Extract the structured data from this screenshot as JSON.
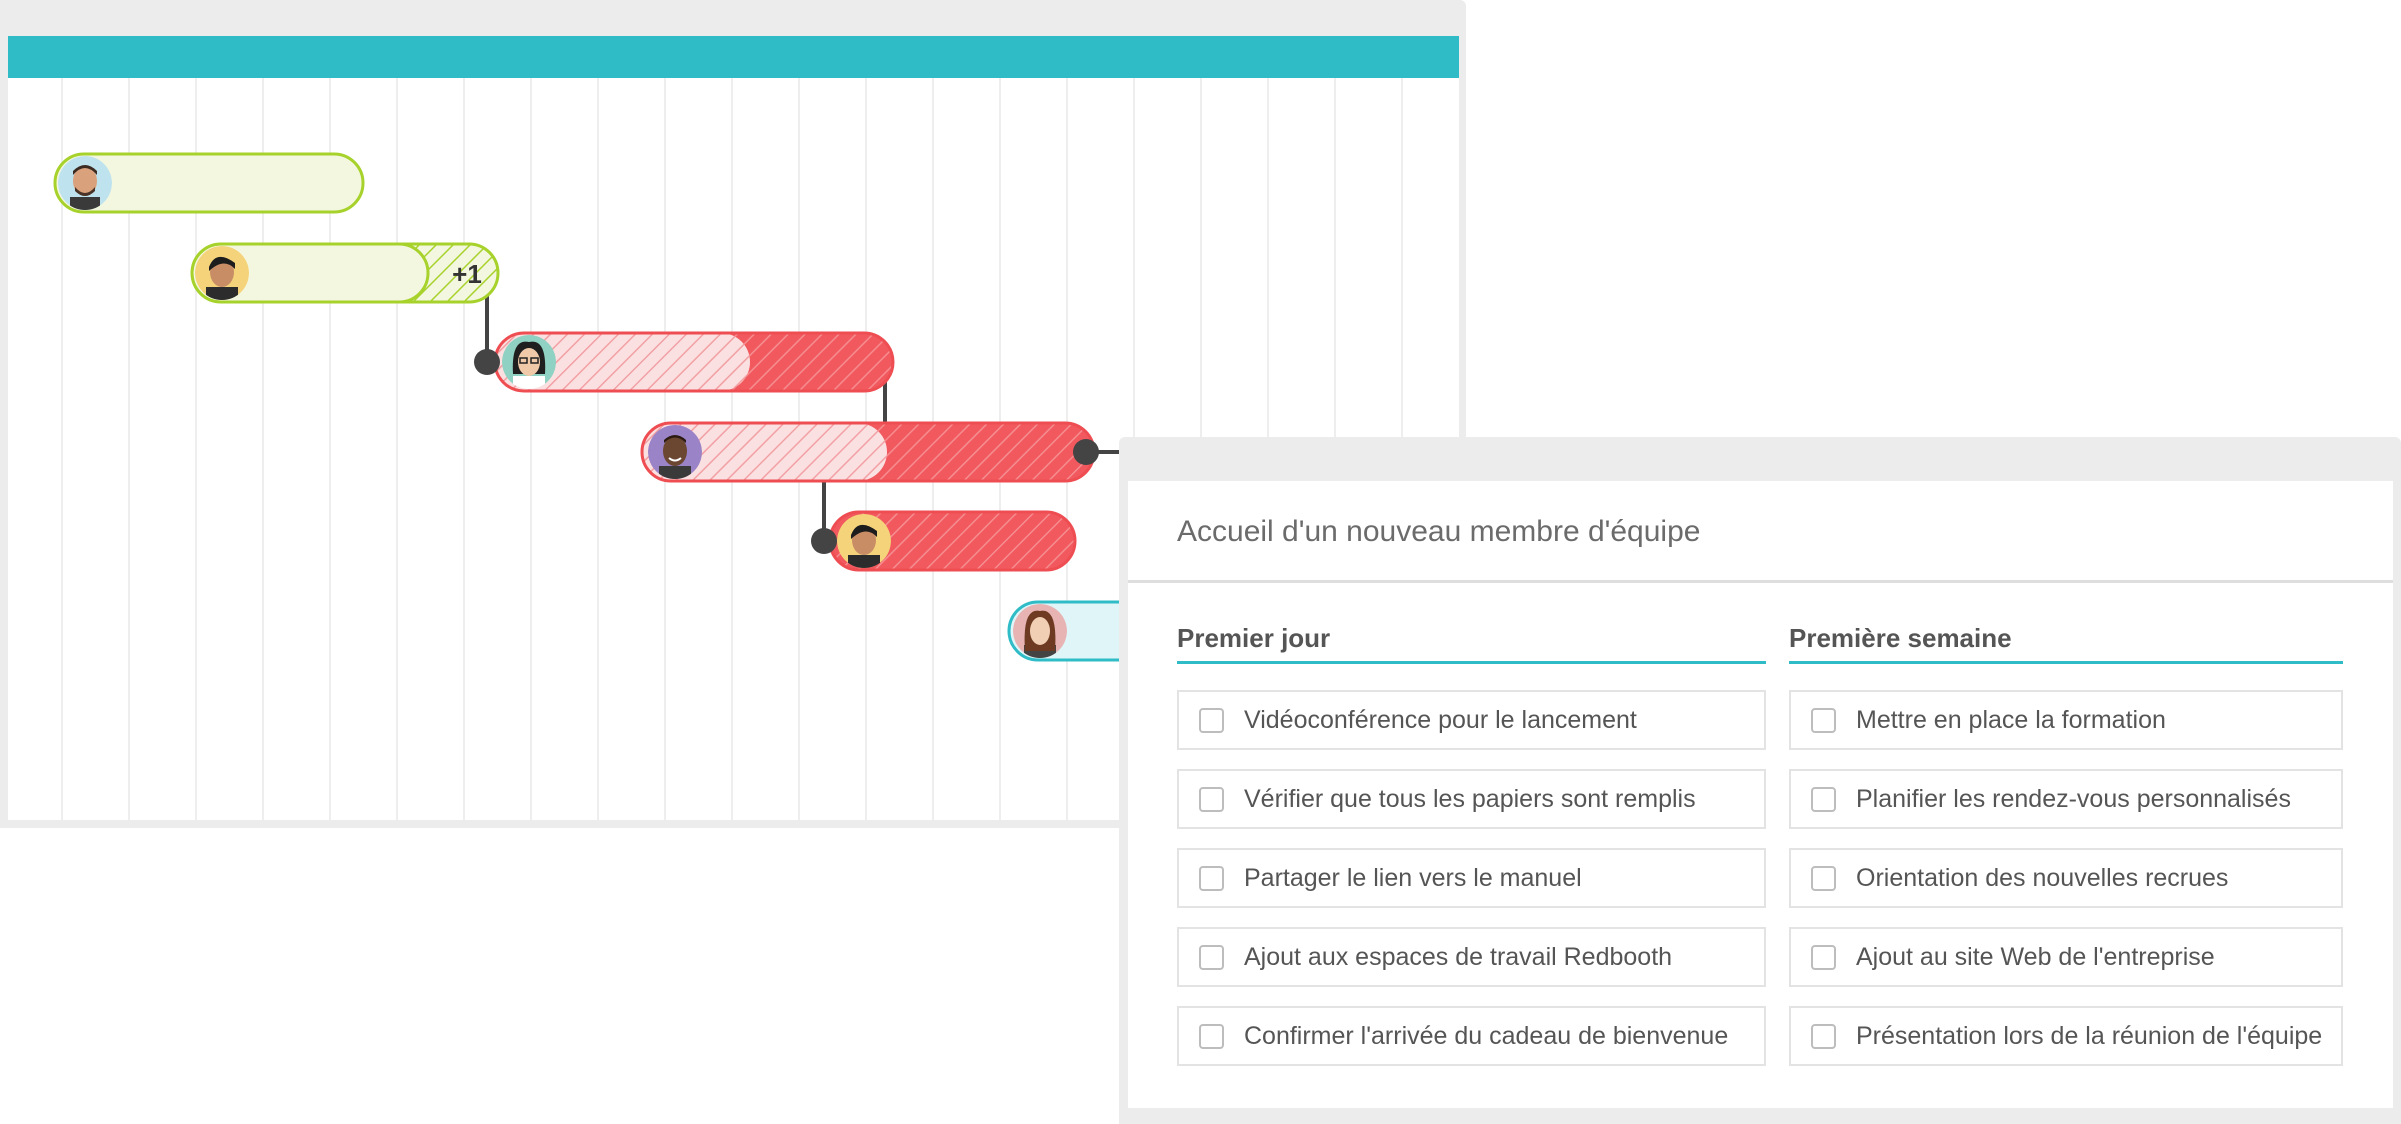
{
  "gantt": {
    "bars": [
      {
        "id": "task-1",
        "status": "upcoming",
        "avatar": "avatar-man-beard",
        "badge": ""
      },
      {
        "id": "task-2",
        "status": "upcoming",
        "avatar": "avatar-man-dark-hair",
        "badge": "+1"
      },
      {
        "id": "task-3",
        "status": "overdue",
        "avatar": "avatar-woman-glasses",
        "badge": ""
      },
      {
        "id": "task-4",
        "status": "overdue",
        "avatar": "avatar-man-smiling",
        "badge": ""
      },
      {
        "id": "task-5",
        "status": "overdue",
        "avatar": "avatar-man-dark-hair",
        "badge": ""
      },
      {
        "id": "task-6",
        "status": "in-progress",
        "avatar": "avatar-woman-long-hair",
        "badge": ""
      }
    ],
    "colors": {
      "header": "#2fbcc7",
      "upcoming_border": "#a6d22b",
      "upcoming_fill": "#f3f7df",
      "overdue_border": "#ee4d52",
      "overdue_fill": "#f7b9bb",
      "overdue_solid": "#f1595e",
      "in_progress_border": "#2fbcc7",
      "in_progress_fill": "#dff5f7",
      "dependency_line": "#444444"
    }
  },
  "checklist": {
    "title": "Accueil d'un nouveau membre d'équipe",
    "columns": [
      {
        "heading": "Premier jour",
        "items": [
          {
            "label": "Vidéoconférence pour le lancement",
            "checked": false
          },
          {
            "label": "Vérifier que tous les papiers sont remplis",
            "checked": false
          },
          {
            "label": "Partager le lien vers le manuel",
            "checked": false
          },
          {
            "label": "Ajout aux espaces de travail Redbooth",
            "checked": false
          },
          {
            "label": "Confirmer l'arrivée du cadeau de bienvenue",
            "checked": false
          }
        ]
      },
      {
        "heading": "Première semaine",
        "items": [
          {
            "label": "Mettre en place la formation",
            "checked": false
          },
          {
            "label": "Planifier les rendez-vous personnalisés",
            "checked": false
          },
          {
            "label": "Orientation des nouvelles recrues",
            "checked": false
          },
          {
            "label": "Ajout au site Web de l'entreprise",
            "checked": false
          },
          {
            "label": "Présentation lors de la réunion de l'équipe",
            "checked": false
          }
        ]
      }
    ]
  }
}
